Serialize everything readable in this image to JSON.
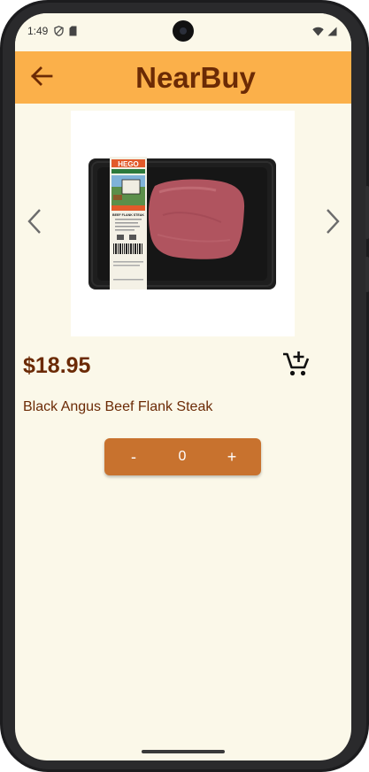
{
  "status_bar": {
    "time": "1:49",
    "left_icons": [
      "shield-icon",
      "sim-card-icon"
    ],
    "right_icons": [
      "wifi-icon",
      "signal-icon"
    ]
  },
  "app_bar": {
    "title": "NearBuy",
    "back_icon": "arrow-left-icon",
    "background": "#fbb04a",
    "title_color": "#6b2a05"
  },
  "product": {
    "image_alt": "Black Angus Beef Flank Steak package",
    "package_brand": "HEGO",
    "package_label": "BEEF FLANK STEAK",
    "price": "$18.95",
    "name": "Black Angus Beef Flank Steak",
    "add_to_cart_icon": "cart-plus-icon"
  },
  "carousel": {
    "prev_icon": "chevron-left-icon",
    "next_icon": "chevron-right-icon"
  },
  "quantity": {
    "minus_label": "-",
    "value": "0",
    "plus_label": "+",
    "background": "#c8722e"
  },
  "colors": {
    "page_background": "#fbf8e9",
    "accent": "#fbb04a",
    "text_brown": "#6b2a05"
  }
}
